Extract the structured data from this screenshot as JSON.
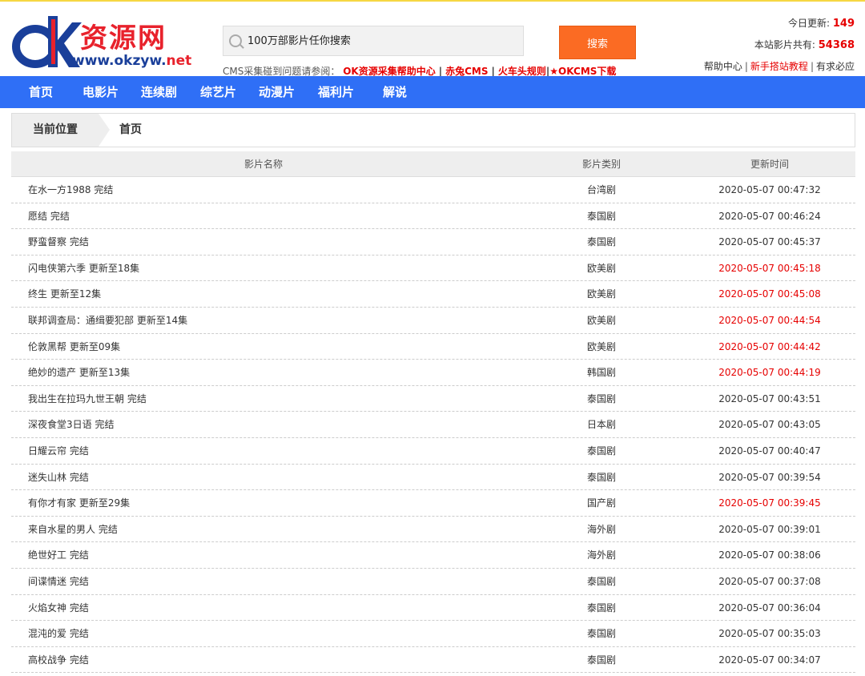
{
  "header": {
    "logo_cn": "资源网",
    "logo_url_main": "www.okzyw.",
    "logo_url_tld": "net",
    "search_placeholder": "100万部影片任你搜索",
    "search_button": "搜索",
    "cms_help": {
      "prefix": "CMS采集碰到问题请参阅：",
      "links": [
        "OK资源采集帮助中心",
        "赤兔CMS",
        "火车头规则",
        "★OKCMS下载"
      ]
    },
    "stats": {
      "today_label": "今日更新:",
      "today_value": "149",
      "total_label": "本站影片共有:",
      "total_value": "54368",
      "links": [
        "帮助中心",
        "新手搭站教程",
        "有求必应"
      ]
    }
  },
  "nav": [
    "首页",
    "电影片",
    "连续剧",
    "综艺片",
    "动漫片",
    "福利片",
    "解说"
  ],
  "breadcrumb": {
    "label": "当前位置",
    "current": "首页"
  },
  "table": {
    "headers": [
      "影片名称",
      "影片类别",
      "更新时间"
    ],
    "rows": [
      {
        "name": "在水一方1988 完结",
        "type": "台湾剧",
        "time": "2020-05-07 00:47:32",
        "hot": false
      },
      {
        "name": "愿结 完结",
        "type": "泰国剧",
        "time": "2020-05-07 00:46:24",
        "hot": false
      },
      {
        "name": "野蛮督察 完结",
        "type": "泰国剧",
        "time": "2020-05-07 00:45:37",
        "hot": false
      },
      {
        "name": "闪电侠第六季 更新至18集",
        "type": "欧美剧",
        "time": "2020-05-07 00:45:18",
        "hot": true
      },
      {
        "name": "终生 更新至12集",
        "type": "欧美剧",
        "time": "2020-05-07 00:45:08",
        "hot": true
      },
      {
        "name": "联邦调查局：通缉要犯部 更新至14集",
        "type": "欧美剧",
        "time": "2020-05-07 00:44:54",
        "hot": true
      },
      {
        "name": "伦敦黑帮 更新至09集",
        "type": "欧美剧",
        "time": "2020-05-07 00:44:42",
        "hot": true
      },
      {
        "name": "绝妙的遗产 更新至13集",
        "type": "韩国剧",
        "time": "2020-05-07 00:44:19",
        "hot": true
      },
      {
        "name": "我出生在拉玛九世王朝 完结",
        "type": "泰国剧",
        "time": "2020-05-07 00:43:51",
        "hot": false
      },
      {
        "name": "深夜食堂3日语 完结",
        "type": "日本剧",
        "time": "2020-05-07 00:43:05",
        "hot": false
      },
      {
        "name": "日耀云帘 完结",
        "type": "泰国剧",
        "time": "2020-05-07 00:40:47",
        "hot": false
      },
      {
        "name": "迷失山林 完结",
        "type": "泰国剧",
        "time": "2020-05-07 00:39:54",
        "hot": false
      },
      {
        "name": "有你才有家 更新至29集",
        "type": "国产剧",
        "time": "2020-05-07 00:39:45",
        "hot": true
      },
      {
        "name": "来自水星的男人 完结",
        "type": "海外剧",
        "time": "2020-05-07 00:39:01",
        "hot": false
      },
      {
        "name": "绝世好工 完结",
        "type": "海外剧",
        "time": "2020-05-07 00:38:06",
        "hot": false
      },
      {
        "name": "间谍情迷 完结",
        "type": "泰国剧",
        "time": "2020-05-07 00:37:08",
        "hot": false
      },
      {
        "name": "火焰女神 完结",
        "type": "泰国剧",
        "time": "2020-05-07 00:36:04",
        "hot": false
      },
      {
        "name": "混沌的爱 完结",
        "type": "泰国剧",
        "time": "2020-05-07 00:35:03",
        "hot": false
      },
      {
        "name": "高校战争 完结",
        "type": "泰国剧",
        "time": "2020-05-07 00:34:07",
        "hot": false
      }
    ]
  },
  "colors": {
    "nav_bg": "#2f6ff6",
    "search_btn": "#fb6b23",
    "highlight": "#e60000"
  }
}
